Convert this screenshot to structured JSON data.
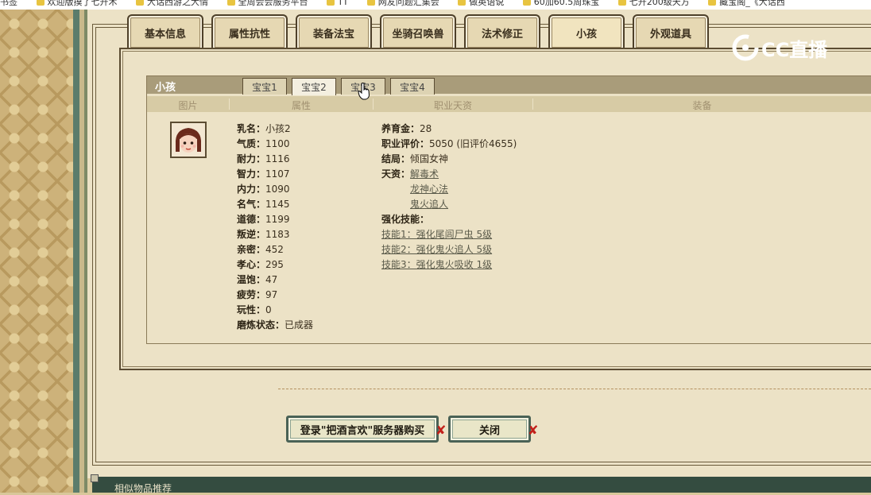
{
  "bookmarks": [
    {
      "label": "书签"
    },
    {
      "label": "欢迎版摸了七开术"
    },
    {
      "label": "大话西游之大情"
    },
    {
      "label": "全周会会服务平台"
    },
    {
      "label": "TT"
    },
    {
      "label": "网友问题汇集会"
    },
    {
      "label": "做英语说"
    },
    {
      "label": "60加60.5周珠宝"
    },
    {
      "label": "七开200级天方"
    },
    {
      "label": "藏宝阁_《大话西"
    }
  ],
  "tabs": [
    {
      "label": "基本信息"
    },
    {
      "label": "属性抗性"
    },
    {
      "label": "装备法宝"
    },
    {
      "label": "坐骑召唤兽"
    },
    {
      "label": "法术修正"
    },
    {
      "label": "小孩"
    },
    {
      "label": "外观道具"
    }
  ],
  "active_tab": "小孩",
  "child_panel": {
    "title": "小孩",
    "subtabs": [
      "宝宝1",
      "宝宝2",
      "宝宝3",
      "宝宝4"
    ],
    "active_subtab": "宝宝2",
    "columns": [
      "图片",
      "属性",
      "职业天资",
      "装备"
    ],
    "attributes": [
      {
        "k": "乳名：",
        "v": "小孩2"
      },
      {
        "k": "气质：",
        "v": "1100"
      },
      {
        "k": "耐力：",
        "v": "1116"
      },
      {
        "k": "智力：",
        "v": "1107"
      },
      {
        "k": "内力：",
        "v": "1090"
      },
      {
        "k": "名气：",
        "v": "1145"
      },
      {
        "k": "道德：",
        "v": "1199"
      },
      {
        "k": "叛逆：",
        "v": "1183"
      },
      {
        "k": "亲密：",
        "v": "452"
      },
      {
        "k": "孝心：",
        "v": "295"
      },
      {
        "k": "温饱：",
        "v": "47"
      },
      {
        "k": "疲劳：",
        "v": "97"
      },
      {
        "k": "玩性：",
        "v": "0"
      },
      {
        "k": "磨炼状态：",
        "v": "已成器"
      }
    ],
    "info": {
      "fee_label": "养育金：",
      "fee_value": "28",
      "rating_label": "职业评价：",
      "rating_value": "5050 (旧评价4655)",
      "ending_label": "结局：",
      "ending_value": "倾国女神",
      "talent_label": "天资：",
      "talents": [
        "解毒术",
        "龙神心法",
        "鬼火追人"
      ],
      "skills_label": "强化技能：",
      "skills": [
        "技能1：强化尾闾尸虫 5级",
        "技能2：强化鬼火追人 5级",
        "技能3：强化鬼火吸收 1级"
      ]
    }
  },
  "buttons": {
    "login_buy": "登录\"把酒言欢\"服务器购买",
    "close": "关闭"
  },
  "footer": {
    "text": "相似物品推荐"
  },
  "watermark": {
    "text": "CC直播"
  },
  "colors": {
    "accent": "#4a6256",
    "header": "#a99c7a",
    "footer": "#344c40"
  }
}
